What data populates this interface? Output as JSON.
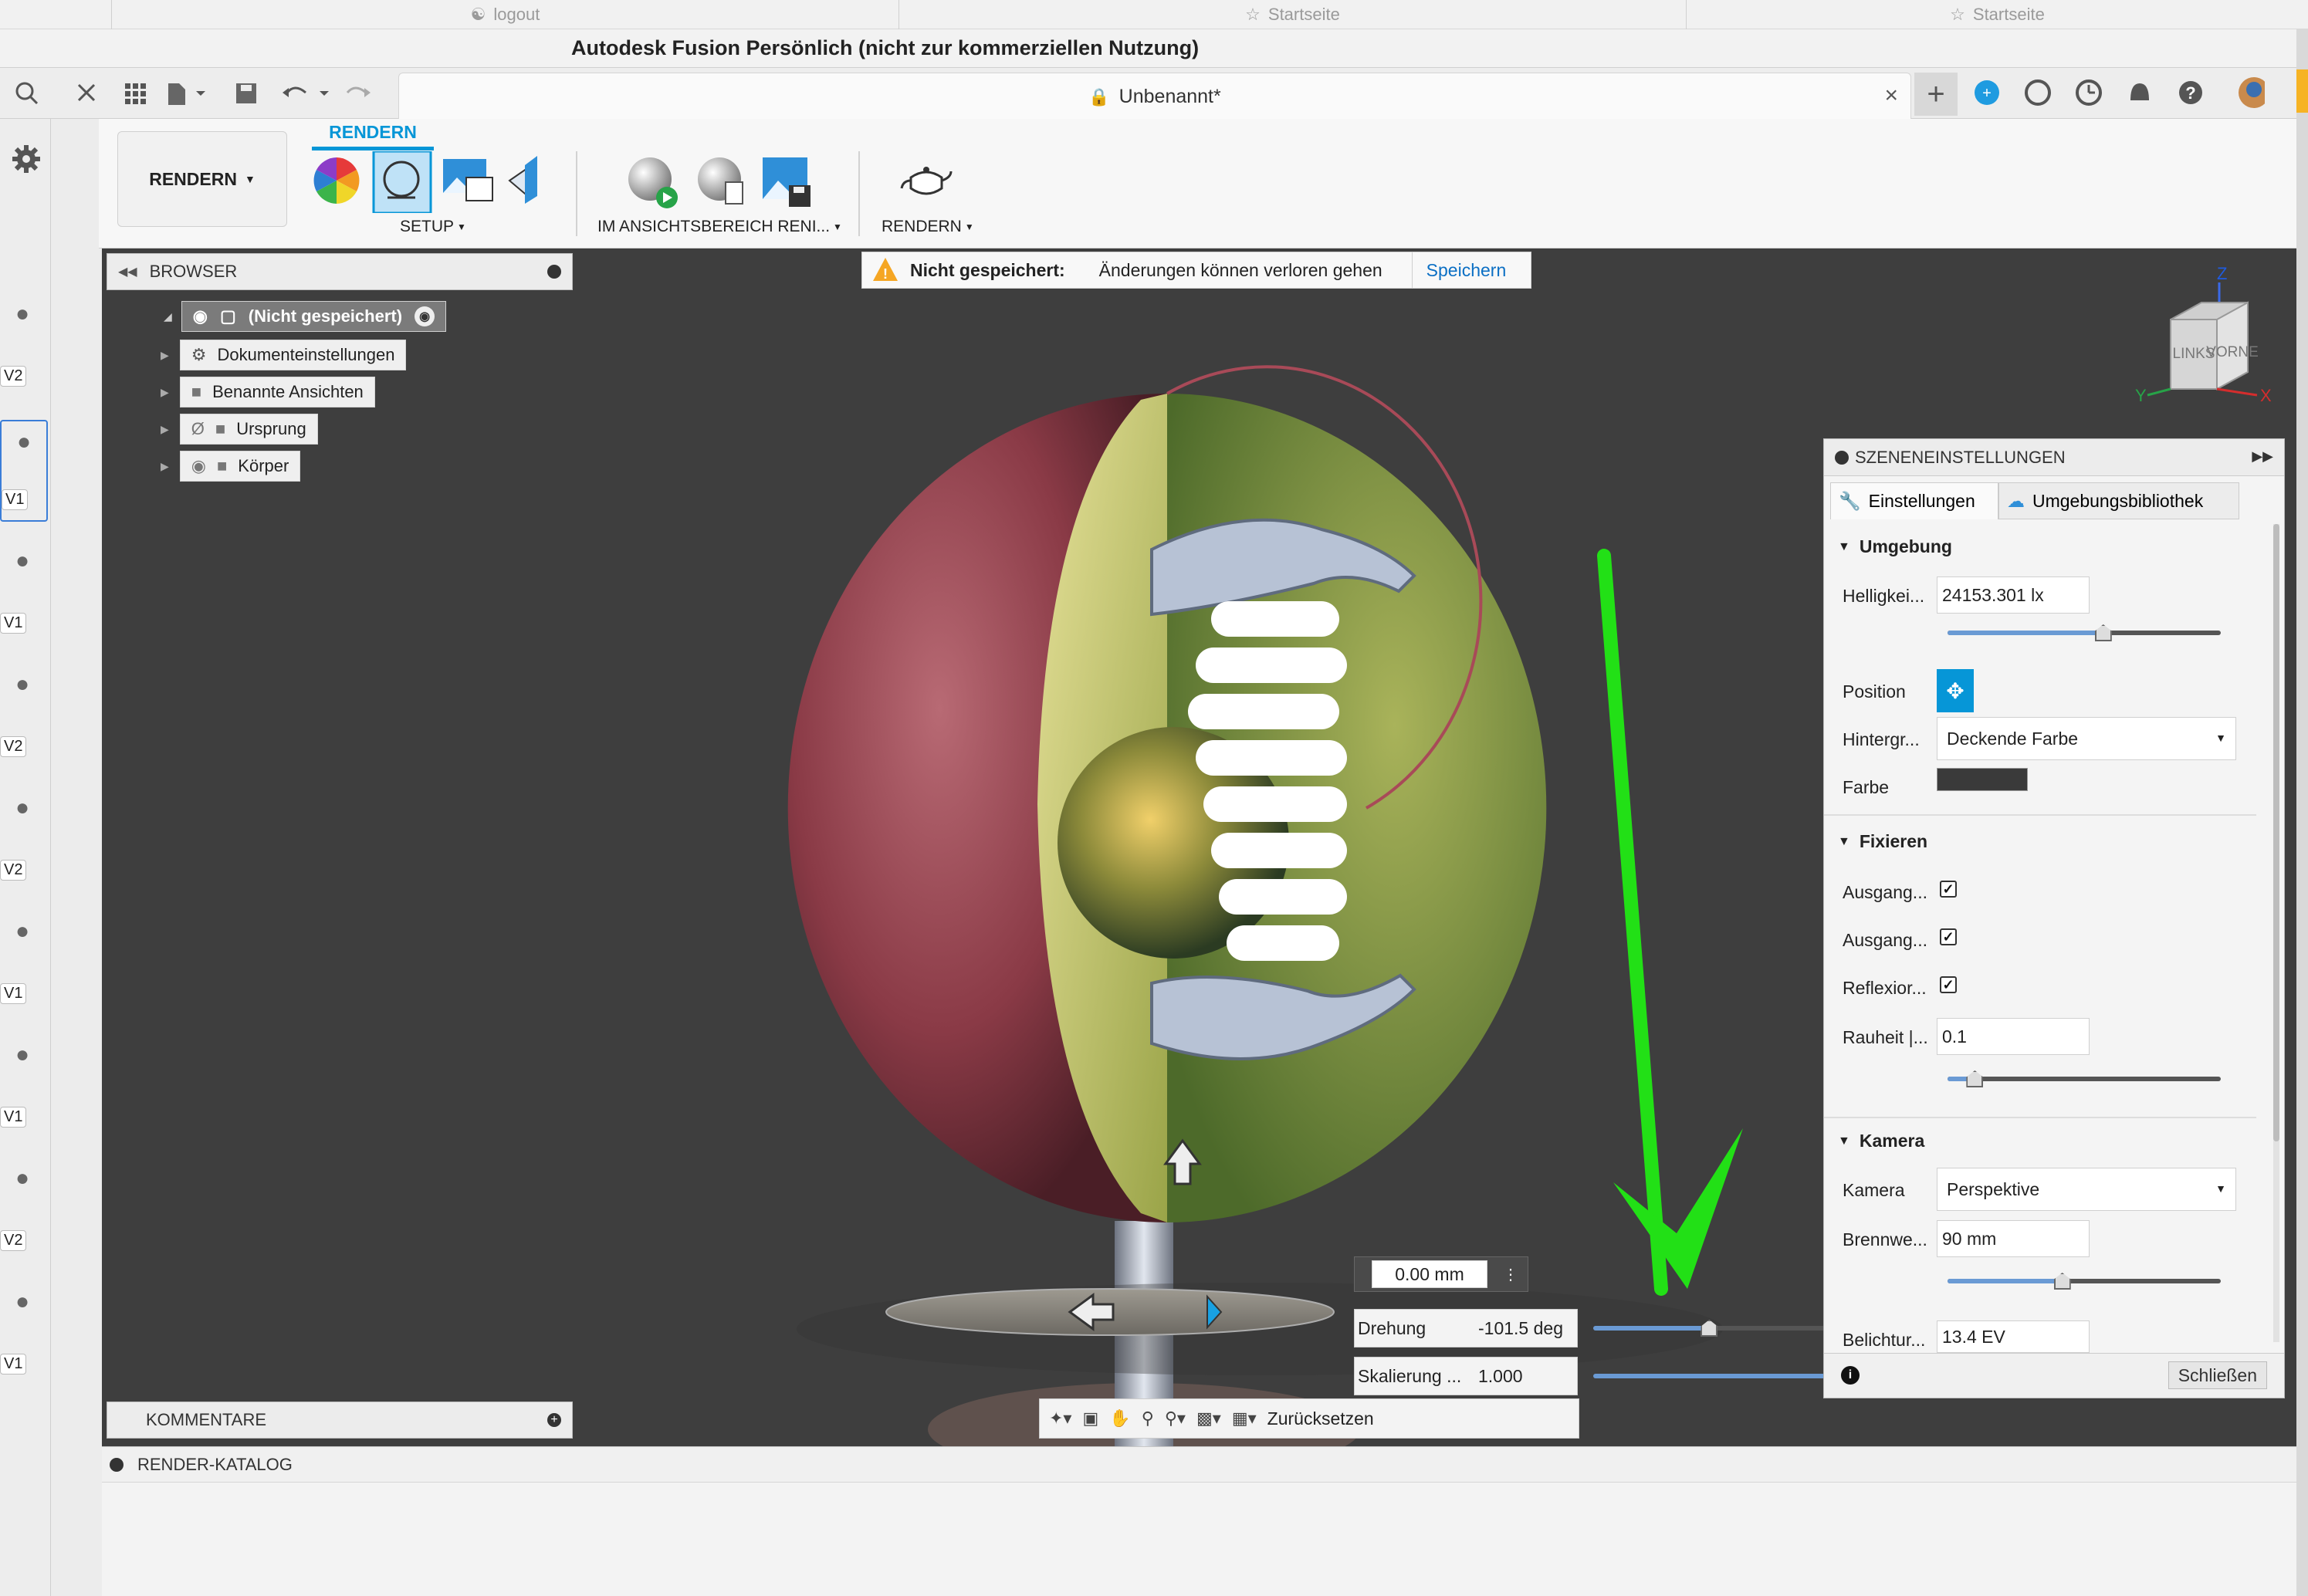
{
  "browser_tabs": [
    {
      "label": "logout"
    },
    {
      "label": "Startseite"
    },
    {
      "label": "Startseite"
    }
  ],
  "window_title": "Autodesk Fusion Persönlich (nicht zur kommerziellen Nutzung)",
  "document_tab": {
    "title": "Unbenannt*"
  },
  "ribbon": {
    "workspace_label": "RENDERN",
    "active_tab": "RENDERN",
    "groups": [
      {
        "label": "SETUP"
      },
      {
        "label": "IM ANSICHTSBEREICH RENI..."
      },
      {
        "label": "RENDERN"
      }
    ]
  },
  "notice": {
    "title": "Nicht gespeichert:",
    "message": "Änderungen können verloren gehen",
    "action": "Speichern"
  },
  "browser": {
    "title": "BROWSER",
    "root": "(Nicht gespeichert)",
    "items": [
      {
        "label": "Dokumenteinstellungen"
      },
      {
        "label": "Benannte Ansichten"
      },
      {
        "label": "Ursprung"
      },
      {
        "label": "Körper"
      }
    ]
  },
  "version_badges": [
    "V2",
    "V1",
    "V1",
    "V2",
    "V2",
    "V1",
    "V1",
    "V2",
    "V1"
  ],
  "comments_title": "KOMMENTARE",
  "render_catalog_title": "RENDER-KATALOG",
  "viewcube": {
    "left": "LINKS",
    "front": "VORNE",
    "axis_z": "Z",
    "axis_y": "Y",
    "axis_x": "X"
  },
  "transform": {
    "distance": "0.00 mm",
    "rotation_label": "Drehung",
    "rotation_value": "-101.5 deg",
    "scale_label": "Skalierung ...",
    "scale_value": "1.000",
    "rotation_slider_fraction": 0.47
  },
  "nav_bar": {
    "reset_label": "Zurücksetzen"
  },
  "scene_settings": {
    "title": "SZENENEINSTELLUNGEN",
    "tabs": [
      {
        "label": "Einstellungen"
      },
      {
        "label": "Umgebungsbibliothek"
      }
    ],
    "environment": {
      "heading": "Umgebung",
      "brightness_label": "Helligkei...",
      "brightness_value": "24153.301 lx",
      "brightness_fraction": 0.57,
      "position_label": "Position",
      "background_label": "Hintergr...",
      "background_value": "Deckende Farbe",
      "color_label": "Farbe",
      "color_value": "#3a3a3a"
    },
    "fix": {
      "heading": "Fixieren",
      "checks": [
        {
          "label": "Ausgang...",
          "checked": "✓"
        },
        {
          "label": "Ausgang...",
          "checked": "✓"
        },
        {
          "label": "Reflexior...",
          "checked": "✓"
        }
      ],
      "roughness_label": "Rauheit |...",
      "roughness_value": "0.1",
      "roughness_fraction": 0.1
    },
    "camera": {
      "heading": "Kamera",
      "camera_label": "Kamera",
      "camera_value": "Perspektive",
      "focal_label": "Brennwe...",
      "focal_value": "90 mm",
      "focal_fraction": 0.42,
      "exposure_label": "Belichtur...",
      "exposure_value": "13.4 EV"
    },
    "close_label": "Schließen"
  },
  "colors": {
    "accent": "#0696d7",
    "annotation_arrow": "#22e016",
    "warning": "#f5a623"
  }
}
